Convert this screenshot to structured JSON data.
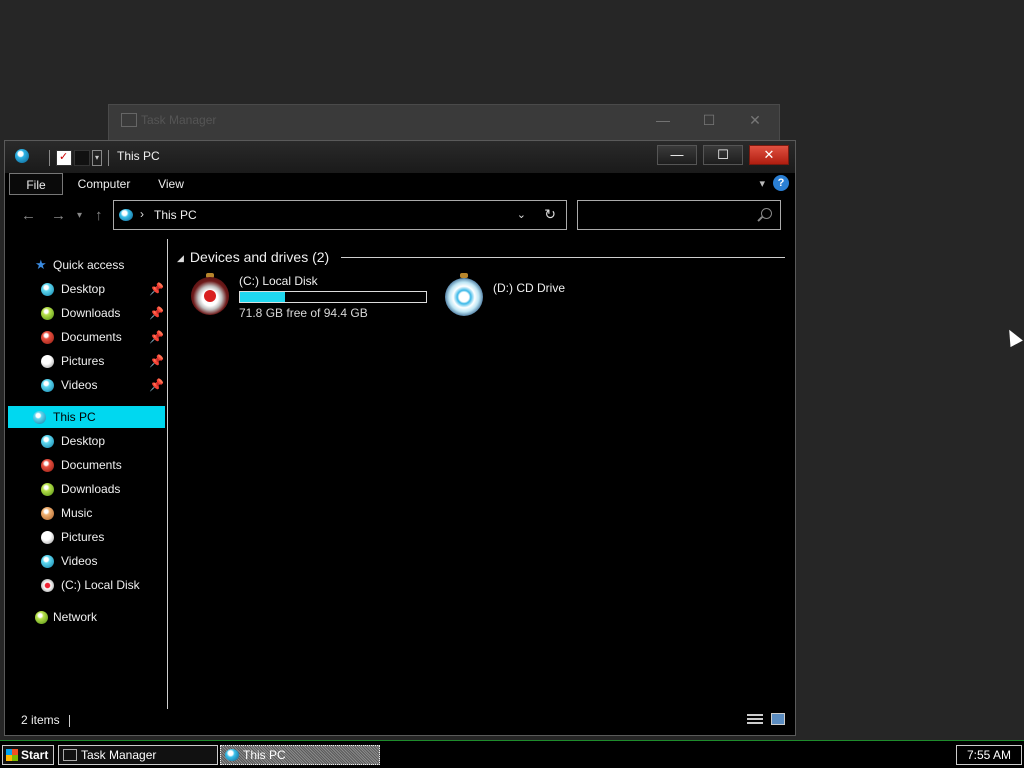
{
  "background_window": {
    "title": "Task Manager"
  },
  "window": {
    "title": "This PC",
    "controls": {
      "minimize": "—",
      "maximize": "☐",
      "close": "✕"
    }
  },
  "ribbon": {
    "tabs": [
      {
        "label": "File"
      },
      {
        "label": "Computer"
      },
      {
        "label": "View"
      }
    ],
    "help": "?"
  },
  "address_bar": {
    "path": "This PC",
    "separator": "›"
  },
  "search": {
    "placeholder": ""
  },
  "nav_pane": {
    "quick_access": {
      "label": "Quick access",
      "items": [
        {
          "label": "Desktop",
          "icon": "desktop-icon",
          "pinned": true
        },
        {
          "label": "Downloads",
          "icon": "downloads-icon",
          "pinned": true
        },
        {
          "label": "Documents",
          "icon": "documents-icon",
          "pinned": true
        },
        {
          "label": "Pictures",
          "icon": "pictures-icon",
          "pinned": true
        },
        {
          "label": "Videos",
          "icon": "videos-icon",
          "pinned": true
        }
      ]
    },
    "this_pc": {
      "label": "This PC",
      "selected": true,
      "items": [
        {
          "label": "Desktop",
          "icon": "desktop-icon"
        },
        {
          "label": "Documents",
          "icon": "documents-icon"
        },
        {
          "label": "Downloads",
          "icon": "downloads-icon"
        },
        {
          "label": "Music",
          "icon": "music-icon"
        },
        {
          "label": "Pictures",
          "icon": "pictures-icon"
        },
        {
          "label": "Videos",
          "icon": "videos-icon"
        },
        {
          "label": "(C:) Local Disk",
          "icon": "local-disk-icon"
        }
      ]
    },
    "network": {
      "label": "Network"
    }
  },
  "content": {
    "group_header": "Devices and drives (2)",
    "drives": [
      {
        "name": "(C:) Local Disk",
        "free_text": "71.8 GB free of 94.4 GB",
        "used_fraction": 0.24,
        "icon": "hard-drive-icon"
      },
      {
        "name": "(D:) CD Drive",
        "icon": "cd-drive-icon"
      }
    ]
  },
  "status_bar": {
    "item_count": "2 items"
  },
  "taskbar": {
    "start_label": "Start",
    "buttons": [
      {
        "label": "Task Manager",
        "active": false
      },
      {
        "label": "This PC",
        "active": true
      }
    ],
    "clock": "7:55 AM"
  },
  "colors": {
    "selection": "#00d8f0",
    "progress_fill": "#20d8f0",
    "close_button": "#c83020",
    "taskbar_border": "#1e8c2c"
  }
}
